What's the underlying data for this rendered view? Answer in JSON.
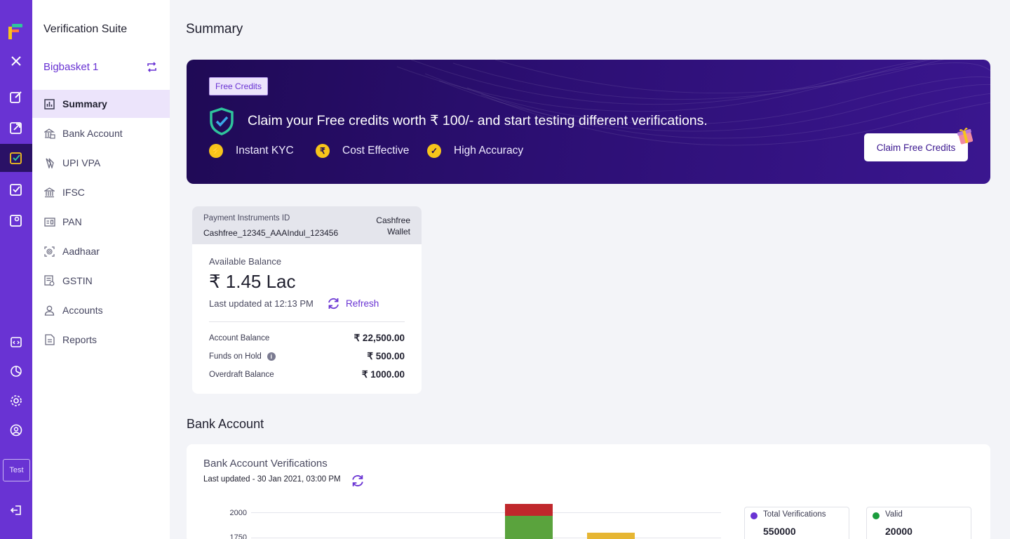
{
  "rail": {
    "test_label": "Test"
  },
  "sidebar": {
    "suite_title": "Verification Suite",
    "merchant_name": "Bigbasket 1",
    "items": [
      {
        "label": "Summary",
        "icon": "chart-icon"
      },
      {
        "label": "Bank Account",
        "icon": "bank-card-icon"
      },
      {
        "label": "UPI VPA",
        "icon": "upi-icon"
      },
      {
        "label": "IFSC",
        "icon": "bank-icon"
      },
      {
        "label": "PAN",
        "icon": "id-card-icon"
      },
      {
        "label": "Aadhaar",
        "icon": "fingerprint-icon"
      },
      {
        "label": "GSTIN",
        "icon": "document-icon"
      },
      {
        "label": "Accounts",
        "icon": "user-icon"
      },
      {
        "label": "Reports",
        "icon": "report-icon"
      }
    ]
  },
  "main": {
    "title": "Summary",
    "banner": {
      "badge": "Free Credits",
      "headline": "Claim your Free credits worth ₹ 100/- and start testing different verifications.",
      "features": [
        "Instant KYC",
        "Cost Effective",
        "High Accuracy"
      ],
      "cta": "Claim Free Credits"
    },
    "wallet": {
      "pid_label": "Payment Instruments ID",
      "pid_value": "Cashfree_12345_AAAIndul_123456",
      "type": "Cashfree Wallet",
      "available_label": "Available Balance",
      "available_amount": "₹ 1.45 Lac",
      "last_updated": "Last updated at 12:13 PM",
      "refresh_label": "Refresh",
      "rows": [
        {
          "label": "Account Balance",
          "value": "₹ 22,500.00"
        },
        {
          "label": "Funds on Hold",
          "value": "₹ 500.00"
        },
        {
          "label": "Overdraft Balance",
          "value": "₹ 1000.00"
        }
      ]
    },
    "bank_section": {
      "title": "Bank Account",
      "panel_title": "Bank Account Verifications",
      "last_updated": "Last updated - 30 Jan 2021, 03:00 PM",
      "stats": [
        {
          "label": "Total Verifications",
          "value": "550000",
          "color": "#6933d3"
        },
        {
          "label": "Valid",
          "value": "20000",
          "color": "#1a9c3c"
        }
      ]
    }
  },
  "chart_data": {
    "type": "bar",
    "y_ticks": [
      "2000",
      "1750"
    ],
    "ylim": [
      1750,
      2000
    ],
    "colors": {
      "green": "#5aa33d",
      "red": "#c0282c",
      "yellow": "#e6b633"
    }
  },
  "colors": {
    "brand": "#6933d3",
    "rail_active": "#2a1166",
    "feature_dot": "#f7c51b"
  }
}
